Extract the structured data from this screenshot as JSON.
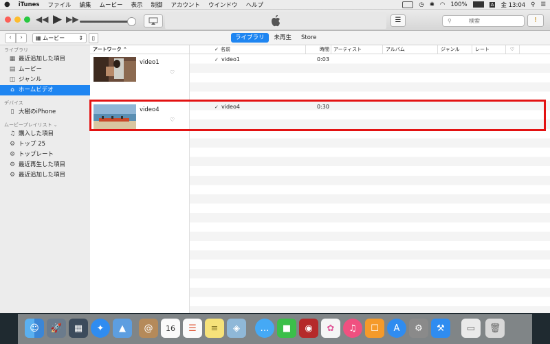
{
  "menubar": {
    "app_name": "iTunes",
    "items": [
      "ファイル",
      "編集",
      "ムービー",
      "表示",
      "制御",
      "アカウント",
      "ウインドウ",
      "ヘルプ"
    ],
    "battery": "100%",
    "input_mode": "A",
    "clock": "金 13:04"
  },
  "toolbar": {
    "search_placeholder": "検索"
  },
  "navbar": {
    "media_label": "ムービー",
    "tabs": [
      {
        "label": "ライブラリ",
        "active": true
      },
      {
        "label": "未再生",
        "active": false
      },
      {
        "label": "Store",
        "active": false
      }
    ]
  },
  "sidebar": {
    "library_header": "ライブラリ",
    "library_items": [
      {
        "label": "最近追加した項目",
        "icon": "recently-added-icon"
      },
      {
        "label": "ムービー",
        "icon": "movie-icon"
      },
      {
        "label": "ジャンル",
        "icon": "genre-icon"
      },
      {
        "label": "ホームビデオ",
        "icon": "home-video-icon",
        "selected": true
      }
    ],
    "devices_header": "デバイス",
    "devices": [
      {
        "label": "大樹のiPhone",
        "icon": "iphone-icon"
      }
    ],
    "playlists_header": "ムービープレイリスト ⌄",
    "playlists": [
      {
        "label": "購入した項目",
        "icon": "purchased-icon"
      },
      {
        "label": "トップ 25",
        "icon": "gear-icon"
      },
      {
        "label": "トップレート",
        "icon": "gear-icon"
      },
      {
        "label": "最近再生した項目",
        "icon": "gear-icon"
      },
      {
        "label": "最近追加した項目",
        "icon": "gear-icon"
      }
    ]
  },
  "table": {
    "headers": {
      "artwork": "アートワーク ⌃",
      "check": "✓",
      "name": "名前",
      "time": "時間",
      "artist": "アーティスト",
      "album": "アルバム",
      "genre": "ジャンル",
      "rating": "レート",
      "love": "♡"
    },
    "items": [
      {
        "title": "video1",
        "name": "video1",
        "time": "0:03",
        "checked": "✓"
      },
      {
        "title": "video4",
        "name": "video4",
        "time": "0:30",
        "checked": "✓"
      }
    ]
  },
  "colors": {
    "accent": "#1e85f1",
    "highlight_box": "#e31212"
  }
}
